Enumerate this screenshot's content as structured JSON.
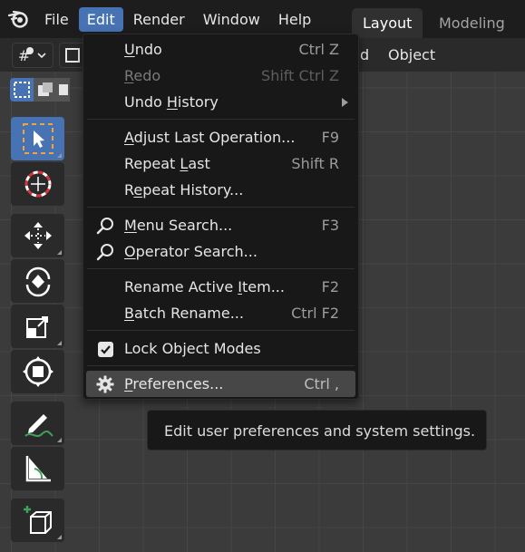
{
  "menubar": {
    "items": [
      {
        "label": "File",
        "active": false
      },
      {
        "label": "Edit",
        "active": true
      },
      {
        "label": "Render",
        "active": false
      },
      {
        "label": "Window",
        "active": false
      },
      {
        "label": "Help",
        "active": false
      }
    ],
    "workspaces": [
      {
        "label": "Layout",
        "active": true
      },
      {
        "label": "Modeling",
        "active": false
      }
    ]
  },
  "header": {
    "partial_label": "d",
    "object_label": "Object"
  },
  "edit_menu": {
    "items": [
      {
        "label_pre": "",
        "label_u": "U",
        "label_post": "ndo",
        "shortcut": "Ctrl Z",
        "disabled": false
      },
      {
        "label_pre": "",
        "label_u": "R",
        "label_post": "edo",
        "shortcut": "Shift Ctrl Z",
        "disabled": true
      },
      {
        "label_pre": "Undo ",
        "label_u": "H",
        "label_post": "istory",
        "shortcut": "",
        "disabled": false,
        "submenu": true
      },
      {
        "label_pre": "",
        "label_u": "A",
        "label_post": "djust Last Operation...",
        "shortcut": "F9",
        "disabled": false
      },
      {
        "label_pre": "Repeat ",
        "label_u": "L",
        "label_post": "ast",
        "shortcut": "Shift R",
        "disabled": false
      },
      {
        "label_pre": "R",
        "label_u": "e",
        "label_post": "peat History...",
        "shortcut": "",
        "disabled": false
      },
      {
        "label_pre": "",
        "label_u": "M",
        "label_post": "enu Search...",
        "shortcut": "F3",
        "disabled": false,
        "icon": "search-icon"
      },
      {
        "label_pre": "",
        "label_u": "O",
        "label_post": "perator Search...",
        "shortcut": "",
        "disabled": false,
        "icon": "search-icon"
      },
      {
        "label_pre": "Rename Active ",
        "label_u": "I",
        "label_post": "tem...",
        "shortcut": "F2",
        "disabled": false
      },
      {
        "label_pre": "",
        "label_u": "B",
        "label_post": "atch Rename...",
        "shortcut": "Ctrl F2",
        "disabled": false
      },
      {
        "label_pre": "Lock Object Modes",
        "label_u": "",
        "label_post": "",
        "shortcut": "",
        "disabled": false,
        "checked": true
      },
      {
        "label_pre": "",
        "label_u": "P",
        "label_post": "references...",
        "shortcut": "Ctrl ,",
        "disabled": false,
        "highlighted": true,
        "icon": "gear-icon"
      }
    ]
  },
  "tooltip": {
    "text": "Edit user preferences and system settings."
  },
  "colors": {
    "accent": "#4772b3",
    "menu_bg": "#181818",
    "viewport_bg": "#3b3b3b",
    "highlight": "#474747"
  }
}
